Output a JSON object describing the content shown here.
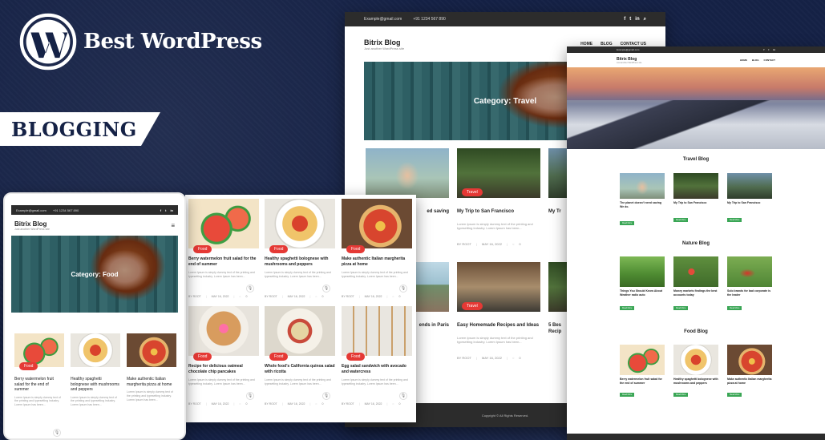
{
  "brand": {
    "name": "Best WordPress",
    "ribbon": "BLOGGING",
    "logo_icon": "wordpress-logo-icon"
  },
  "common": {
    "email": "Example@gmail.com",
    "phone": "+91 1234 567 890",
    "site_title": "Bitrix Blog",
    "tagline": "Just another WordPress site",
    "read_more": "Read More",
    "author": "BY ROOT",
    "date": "MAY 16, 2022",
    "comments": "0",
    "food_badge": "Food",
    "travel_badge": "Travel"
  },
  "mobile": {
    "hero_title": "Category: Food",
    "cards": [
      {
        "title": "Berry watermelon fruit salad for the end of summer",
        "excerpt": "Lorem Ipsum is simply dummy text of the printing and typesetting industry. Lorem Ipsum has been..."
      },
      {
        "title": "Healthy spaghetti bolognese with mushrooms and peppers",
        "excerpt": "Lorem Ipsum is simply dummy text of the printing and typesetting industry. Lorem Ipsum has been..."
      },
      {
        "title": "Make authentic Italian margherita pizza at home",
        "excerpt": "Lorem Ipsum is simply dummy text of the printing and typesetting industry. Lorem Ipsum has been..."
      }
    ]
  },
  "food_grid": {
    "cards": [
      {
        "title": "Berry watermelon fruit salad for the end of summer",
        "excerpt": "Lorem Ipsum is simply dummy text of the printing and typesetting industry. Lorem Ipsum has been..."
      },
      {
        "title": "Healthy spaghetti bolognese with mushrooms and peppers",
        "excerpt": "Lorem Ipsum is simply dummy text of the printing and typesetting industry. Lorem Ipsum has been..."
      },
      {
        "title": "Make authentic Italian margherita pizza at home",
        "excerpt": "Lorem Ipsum is simply dummy text of the printing and typesetting industry. Lorem Ipsum has been..."
      },
      {
        "title": "Recipe for delicious oatmeal chocolate chip pancakes",
        "excerpt": "Lorem Ipsum is simply dummy text of the printing and typesetting industry. Lorem Ipsum has been..."
      },
      {
        "title": "Whole food's California quinoa salad with ricotta",
        "excerpt": "Lorem Ipsum is simply dummy text of the printing and typesetting industry. Lorem Ipsum has been..."
      },
      {
        "title": "Egg salad sandwich with avocado and watercress",
        "excerpt": "Lorem Ipsum is simply dummy text of the printing and typesetting industry. Lorem Ipsum has been..."
      }
    ]
  },
  "travel_page": {
    "nav": [
      "HOME",
      "BLOG",
      "CONTACT US"
    ],
    "hero_title": "Category: Travel",
    "cards": [
      {
        "title": "My Trip to San Francisco",
        "excerpt": "Lorem Ipsum is simply dummy text of the printing and typesetting industry. Lorem Ipsum has been..."
      },
      {
        "title": "Easy Homemade Recipes and Ideas",
        "excerpt": "Lorem Ipsum is simply dummy text of the printing and typesetting industry. Lorem Ipsum has been..."
      }
    ],
    "partial_1": "ed saving",
    "partial_2": "ends in Paris",
    "partial_3": "My Tr",
    "partial_4": "5 Bes Recip",
    "copyright": "Copyright © All Rights Reserved."
  },
  "home_page": {
    "nav": [
      "HOME",
      "BLOG",
      "CONTACT"
    ],
    "sections": [
      {
        "heading": "Travel Blog",
        "cards": [
          {
            "title": "The planet doesn't need saving We do."
          },
          {
            "title": "My Trip to San Francisco"
          },
          {
            "title": "My Trip to San Francisco"
          }
        ]
      },
      {
        "heading": "Nature Blog",
        "cards": [
          {
            "title": "Things You Should Know About Weather radio auto"
          },
          {
            "title": "Money markets findings the best accounts today"
          },
          {
            "title": "Solo brands for bad corporate is the leader"
          }
        ]
      },
      {
        "heading": "Food Blog",
        "cards": [
          {
            "title": "Berry watermelon fruit salad for the end of summer"
          },
          {
            "title": "Healthy spaghetti bolognese with mushrooms and peppers"
          },
          {
            "title": "Make authentic Italian margherita pizza at home"
          }
        ]
      }
    ]
  }
}
